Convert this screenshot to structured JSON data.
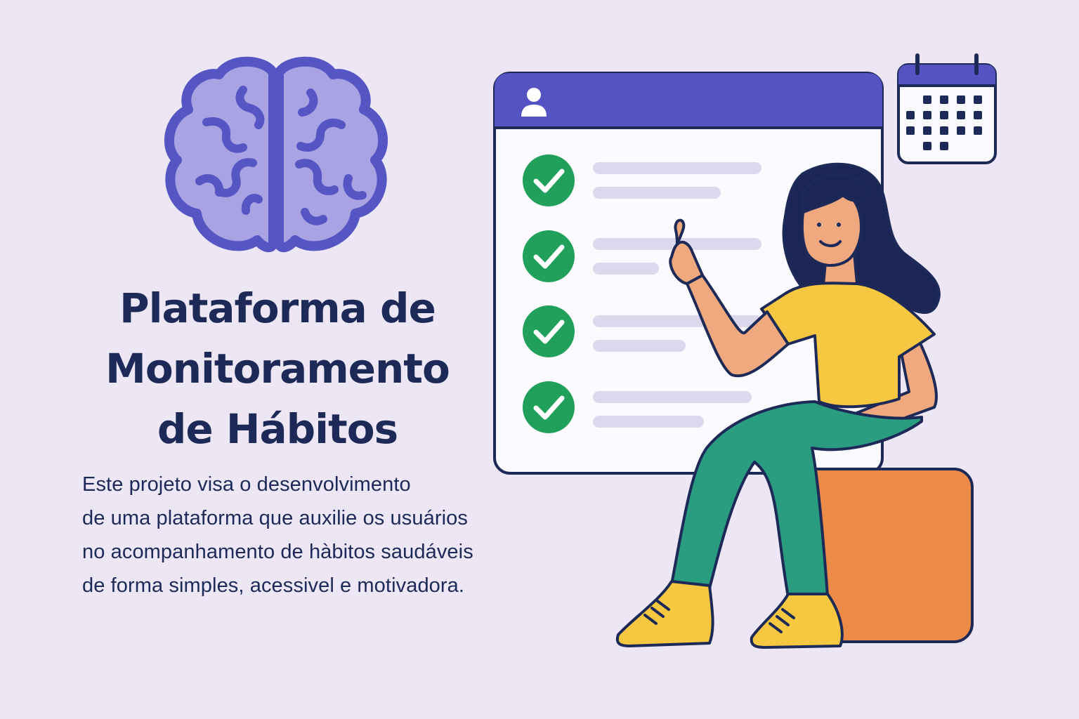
{
  "title": {
    "lines": [
      "Plataforma de",
      "Monitoramento",
      "de Hábitos"
    ]
  },
  "description": {
    "lines": [
      "Este projeto visa o desenvolvimento",
      "de uma plataforma que auxilie os usuários",
      "no acompanhamento de hàbitos saudáveis",
      "de forma simples, acessivel e motivadora."
    ]
  },
  "icons": {
    "brain": "brain-icon",
    "user": "user-icon",
    "check": "check-circle-icon",
    "calendar": "calendar-icon"
  },
  "checklist": {
    "items_completed": 4,
    "items_total": 4
  },
  "colors": {
    "background": "#ece6f5",
    "title_text": "#1d2a57",
    "brain_fill": "#a9a3e3",
    "brain_stroke": "#5555c4",
    "window_header": "#5552c2",
    "check_green": "#20a05a",
    "placeholder_bar": "#dcd8ee",
    "shirt_yellow": "#f6c740",
    "pants_green": "#2a9c80",
    "stool_orange": "#ec8a48",
    "skin": "#f0a87e",
    "hair": "#1b2656"
  }
}
